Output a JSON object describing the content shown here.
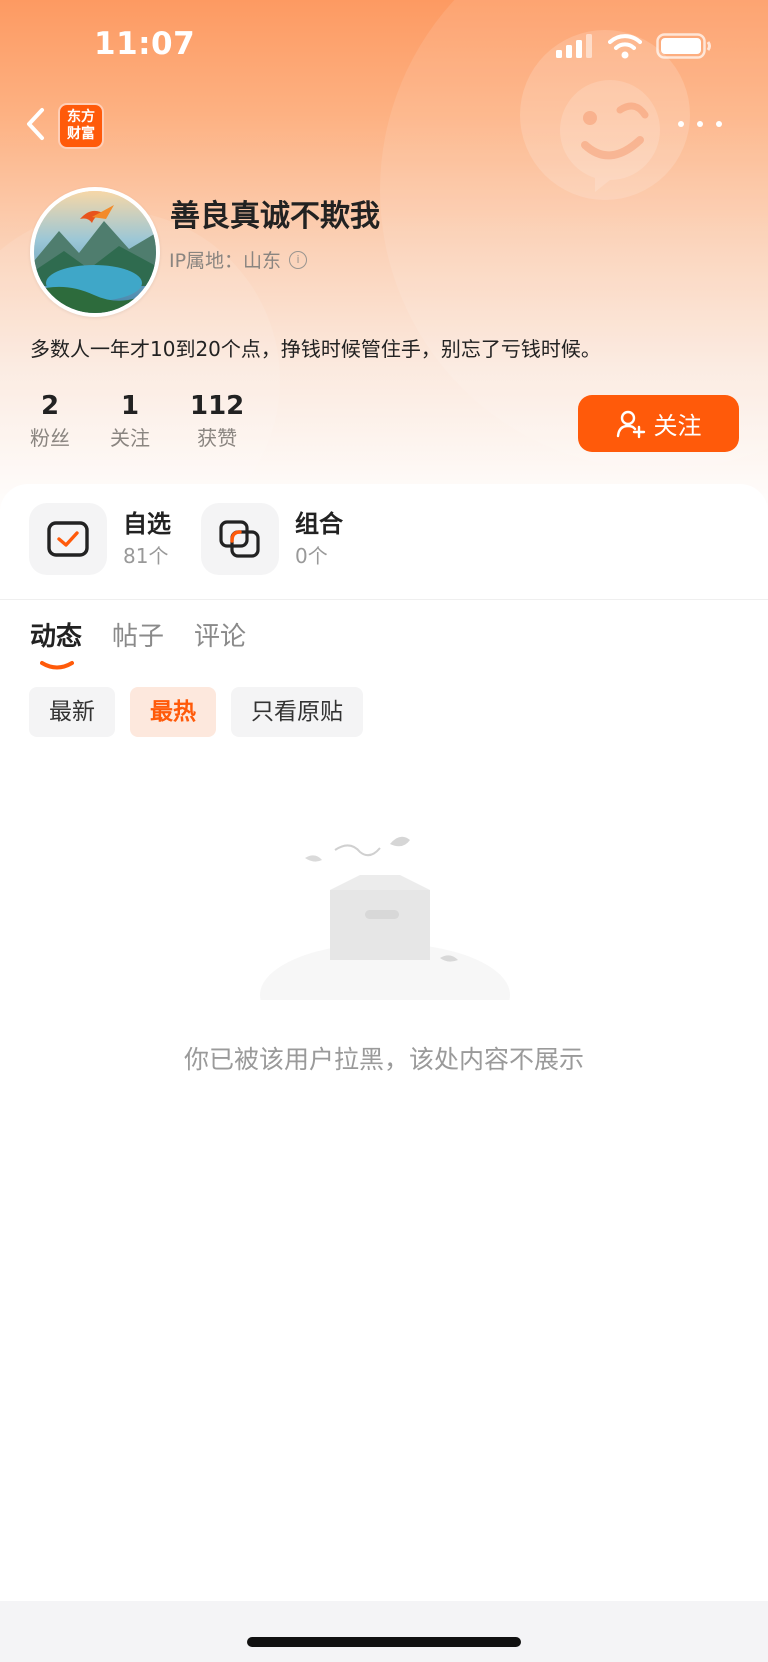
{
  "status_bar": {
    "time": "11:07"
  },
  "nav": {
    "logo_line1": "东方",
    "logo_line2": "财富"
  },
  "profile": {
    "username": "善良真诚不欺我",
    "ip_label": "IP属地：山东",
    "bio": "多数人一年才10到20个点，挣钱时候管住手，别忘了亏钱时候。"
  },
  "stats": [
    {
      "value": "2",
      "label": "粉丝"
    },
    {
      "value": "1",
      "label": "关注"
    },
    {
      "value": "112",
      "label": "获赞"
    }
  ],
  "follow_button": {
    "label": "关注"
  },
  "quick": [
    {
      "title": "自选",
      "sub": "81个",
      "icon": "checkbox-icon"
    },
    {
      "title": "组合",
      "sub": "0个",
      "icon": "portfolio-icon"
    }
  ],
  "tabs": [
    "动态",
    "帖子",
    "评论"
  ],
  "chips": [
    "最新",
    "最热",
    "只看原贴"
  ],
  "empty_state": {
    "text": "你已被该用户拉黑，该处内容不展示"
  },
  "colors": {
    "accent": "#ff5a0a",
    "accent_soft": "#fde8dd",
    "header_top": "#fd9a62"
  }
}
